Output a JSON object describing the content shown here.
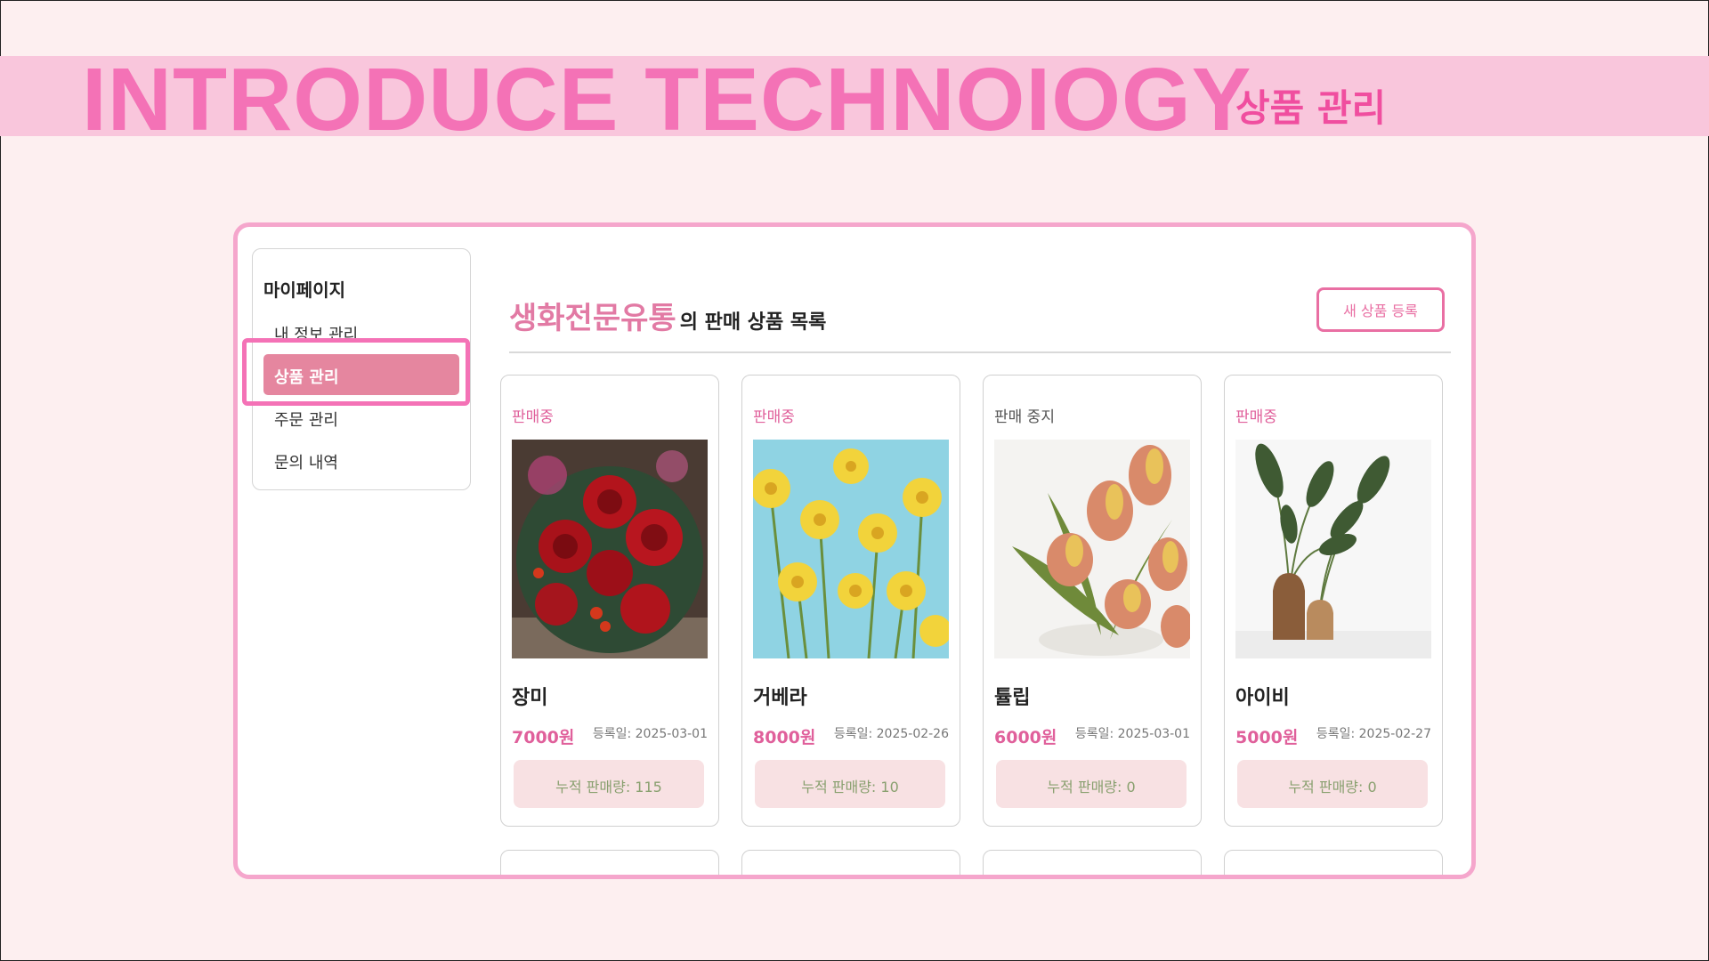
{
  "banner": {
    "title": "INTRODUCE TECHNOIOGY",
    "subtitle": "상품 관리"
  },
  "sidebar": {
    "title": "마이페이지",
    "items": [
      {
        "label": "내 정보 관리"
      },
      {
        "label": "상품 관리",
        "active": true
      },
      {
        "label": "주문 관리"
      },
      {
        "label": "문의 내역"
      }
    ]
  },
  "main": {
    "store_name": "생화전문유통",
    "heading_rest": "의 판매 상품 목록",
    "new_button_label": "새 상품 등록"
  },
  "products": [
    {
      "status": "판매중",
      "name": "장미",
      "price": "7000원",
      "date": "등록일: 2025-03-01",
      "sales": "누적 판매량: 115",
      "image": "red-rose-bouquet"
    },
    {
      "status": "판매중",
      "name": "거베라",
      "price": "8000원",
      "date": "등록일: 2025-02-26",
      "sales": "누적 판매량: 10",
      "image": "yellow-gerbera"
    },
    {
      "status": "판매 중지",
      "name": "튤립",
      "price": "6000원",
      "date": "등록일: 2025-03-01",
      "sales": "누적 판매량: 0",
      "image": "pink-tulips"
    },
    {
      "status": "판매중",
      "name": "아이비",
      "price": "5000원",
      "date": "등록일: 2025-02-27",
      "sales": "누적 판매량: 0",
      "image": "green-plant-vase"
    }
  ],
  "colors": {
    "accent": "#e0609b",
    "banner_bg": "#f9c6dc",
    "page_bg": "#fdeff0",
    "active_menu": "#e5869f"
  }
}
